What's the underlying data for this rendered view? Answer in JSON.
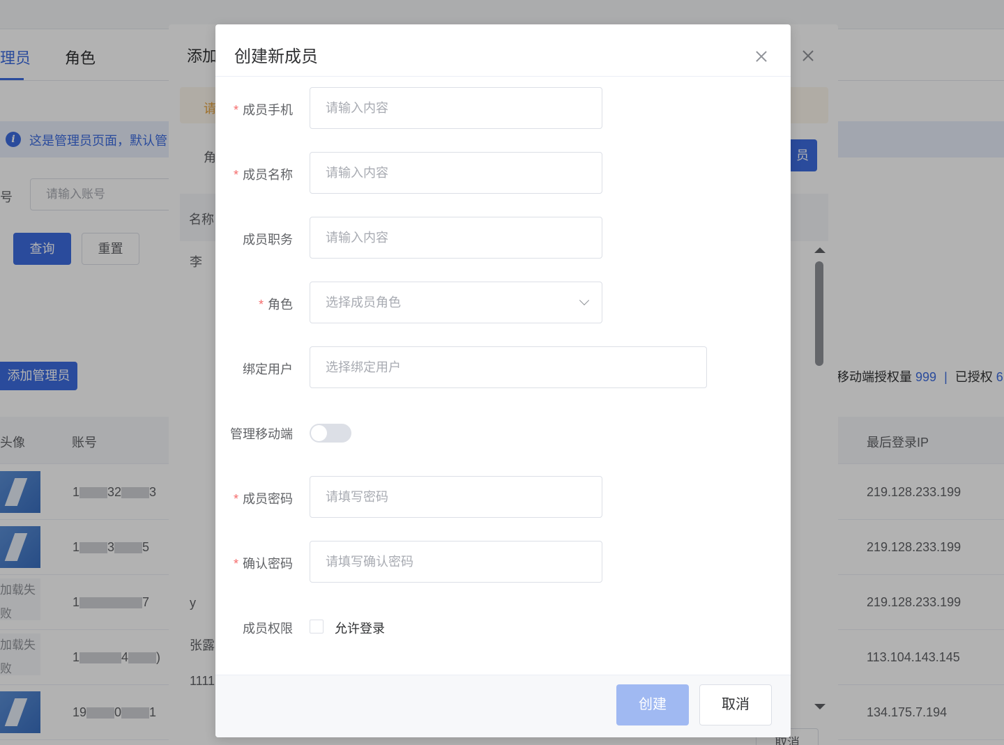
{
  "background": {
    "tabs": [
      {
        "label": "理员"
      },
      {
        "label": "角色"
      }
    ],
    "info_text": "这是管理员页面，默认管",
    "account_label": "号",
    "account_placeholder": "请输入账号",
    "query_label": "查询",
    "reset_label": "重置",
    "add_admin_label": "添加管理员",
    "quota": {
      "mobile_label": "移动端授权量",
      "mobile_value": "999",
      "sep": "|",
      "granted_label": "已授权",
      "granted_value": "6"
    },
    "columns": [
      "头像",
      "账号",
      "最后登录IP"
    ],
    "rows": [
      {
        "avatar_fail": "",
        "account_parts": [
          "1",
          "32",
          "3"
        ],
        "ip": "219.128.233.199"
      },
      {
        "avatar_fail": "",
        "account_parts": [
          "1",
          "3",
          "5"
        ],
        "ip": "219.128.233.199"
      },
      {
        "avatar_fail": "加载失败",
        "account_parts": [
          "1",
          "",
          "7"
        ],
        "ip": "219.128.233.199"
      },
      {
        "avatar_fail": "加载失败",
        "account_parts": [
          "1",
          "4",
          ")"
        ],
        "ip": "113.104.143.145"
      },
      {
        "avatar_fail": "",
        "account_parts": [
          "19",
          "0",
          "1"
        ],
        "ip": "134.175.7.194"
      }
    ]
  },
  "second_dialog": {
    "title": "添加",
    "warn": "请",
    "role_label": "角",
    "button_label": "员",
    "col_name": "名称",
    "cells": [
      "李",
      "",
      "",
      "",
      "",
      "",
      "",
      "",
      "y",
      "张露",
      "1111"
    ],
    "footer_btn": "取消"
  },
  "dialog": {
    "title": "创建新成员",
    "fields": [
      {
        "label": "成员手机",
        "required": true,
        "placeholder": "请输入内容"
      },
      {
        "label": "成员名称",
        "required": true,
        "placeholder": "请输入内容"
      },
      {
        "label": "成员职务",
        "required": false,
        "placeholder": "请输入内容"
      },
      {
        "label": "角色",
        "required": true,
        "placeholder": "选择成员角色"
      },
      {
        "label": "绑定用户",
        "required": false,
        "placeholder": "选择绑定用户"
      },
      {
        "label": "管理移动端",
        "required": false
      },
      {
        "label": "成员密码",
        "required": true,
        "placeholder": "请填写密码"
      },
      {
        "label": "确认密码",
        "required": true,
        "placeholder": "请填写确认密码"
      },
      {
        "label": "成员权限",
        "required": false,
        "checkbox_label": "允许登录"
      }
    ],
    "required_mark": "*",
    "mobile_switch_on": false,
    "allow_login_checked": false,
    "create_label": "创建",
    "cancel_label": "取消"
  },
  "colors": {
    "primary": "#3d6ce0",
    "required": "#f56c6c",
    "create_disabled": "#a0b9f2"
  }
}
